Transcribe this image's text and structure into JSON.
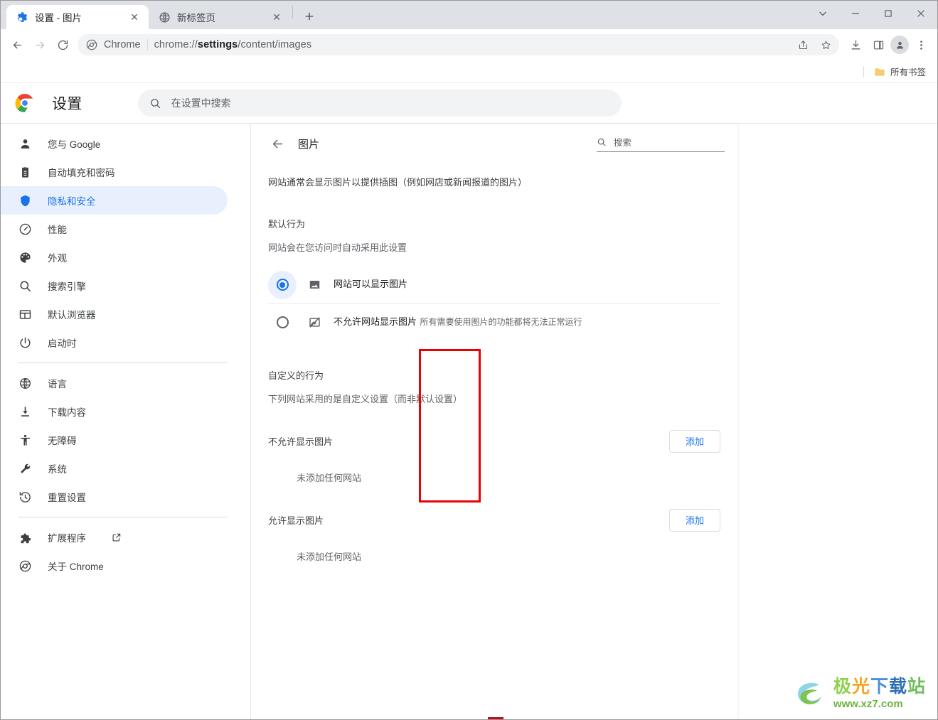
{
  "window": {
    "controls": {
      "tab_search": "chevron-down-icon",
      "minimize": "minimize-icon",
      "maximize": "maximize-icon",
      "close": "close-icon"
    }
  },
  "tabs": [
    {
      "title": "设置 - 图片",
      "favicon": "gear-icon",
      "active": true,
      "close": "✕"
    },
    {
      "title": "新标签页",
      "favicon": "globe-icon",
      "active": false,
      "close": "✕"
    }
  ],
  "new_tab_button_label": "+",
  "toolbar": {
    "back": "back-arrow-icon",
    "forward": "forward-arrow-icon",
    "reload": "reload-icon",
    "omnibox": {
      "site_label": "Chrome",
      "url_scheme": "chrome://",
      "url_bold": "settings",
      "url_rest": "/content/images",
      "share_icon": "share-icon",
      "bookmark_icon": "star-icon"
    },
    "downloads": "download-icon",
    "side_panel": "side-panel-icon",
    "profile": "profile-avatar-icon",
    "menu": "three-dot-menu-icon"
  },
  "bookmarks_bar": {
    "all_bookmarks_label": "所有书签",
    "folder_icon": "folder-icon"
  },
  "settings": {
    "logo": "chrome-logo",
    "title": "设置",
    "search": {
      "placeholder": "在设置中搜索",
      "icon": "search-icon"
    },
    "sidebar": [
      {
        "label": "您与 Google",
        "icon": "person-icon",
        "selected": false
      },
      {
        "label": "自动填充和密码",
        "icon": "clipboard-icon",
        "selected": false
      },
      {
        "label": "隐私和安全",
        "icon": "shield-icon",
        "selected": true
      },
      {
        "label": "性能",
        "icon": "speedometer-icon",
        "selected": false
      },
      {
        "label": "外观",
        "icon": "palette-icon",
        "selected": false
      },
      {
        "label": "搜索引擎",
        "icon": "search-icon",
        "selected": false
      },
      {
        "label": "默认浏览器",
        "icon": "browser-window-icon",
        "selected": false
      },
      {
        "label": "启动时",
        "icon": "power-icon",
        "selected": false
      },
      {
        "divider": true
      },
      {
        "label": "语言",
        "icon": "globe-icon",
        "selected": false
      },
      {
        "label": "下载内容",
        "icon": "download-icon",
        "selected": false
      },
      {
        "label": "无障碍",
        "icon": "accessibility-icon",
        "selected": false
      },
      {
        "label": "系统",
        "icon": "wrench-icon",
        "selected": false
      },
      {
        "label": "重置设置",
        "icon": "history-restore-icon",
        "selected": false
      },
      {
        "divider": true
      },
      {
        "label": "扩展程序",
        "icon": "puzzle-icon",
        "external": "open-in-new-icon",
        "selected": false
      },
      {
        "label": "关于 Chrome",
        "icon": "chrome-outline-icon",
        "selected": false
      }
    ]
  },
  "content": {
    "back_icon": "back-arrow-icon",
    "title": "图片",
    "search": {
      "placeholder": "搜索",
      "icon": "search-icon"
    },
    "description": "网站通常会显示图片以提供插图（例如网店或新闻报道的图片）",
    "default_behavior": {
      "heading": "默认行为",
      "subtext": "网站会在您访问时自动采用此设置",
      "options": [
        {
          "title": "网站可以显示图片",
          "subtitle": "",
          "icon": "image-icon",
          "selected": true
        },
        {
          "title": "不允许网站显示图片",
          "subtitle": "所有需要使用图片的功能都将无法正常运行",
          "icon": "image-blocked-icon",
          "selected": false
        }
      ]
    },
    "custom_behavior": {
      "heading": "自定义的行为",
      "subtext": "下列网站采用的是自定义设置（而非默认设置）",
      "groups": [
        {
          "label": "不允许显示图片",
          "add_button": "添加",
          "empty_text": "未添加任何网站"
        },
        {
          "label": "允许显示图片",
          "add_button": "添加",
          "empty_text": "未添加任何网站"
        }
      ]
    }
  },
  "annotation": {
    "color": "#ee0000",
    "highlights": [
      "add-buttons-column"
    ]
  },
  "watermark": {
    "chars": [
      "极",
      "光",
      "下",
      "载",
      "站"
    ],
    "url": "www.xz7.com"
  }
}
